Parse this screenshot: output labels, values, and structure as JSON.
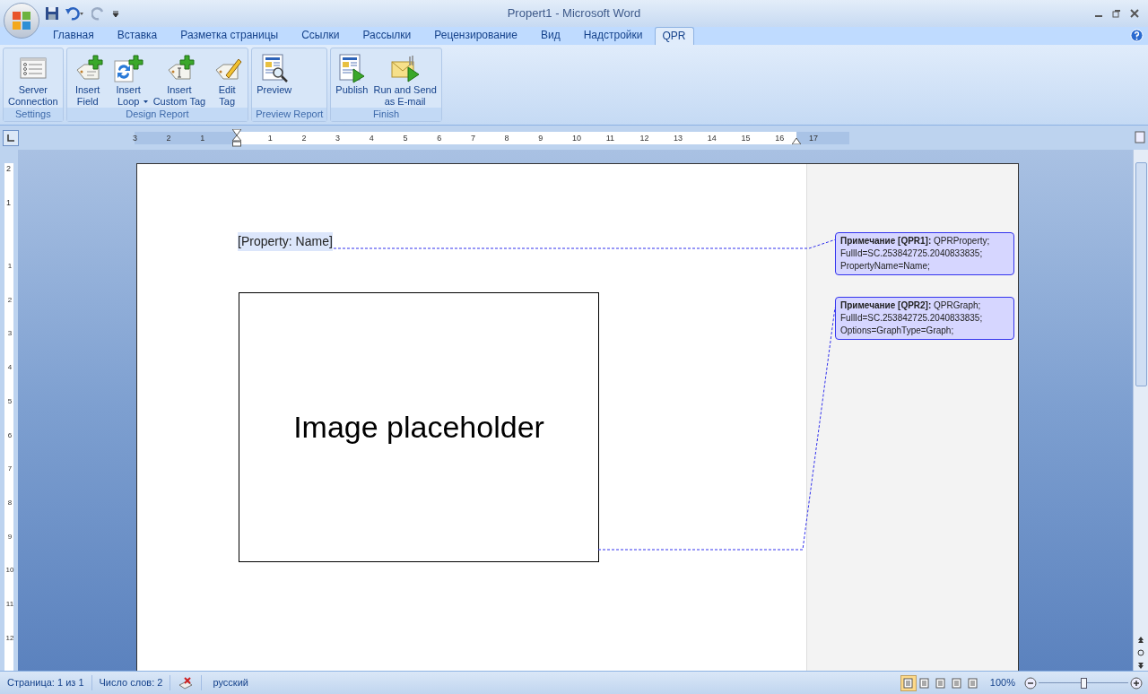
{
  "window": {
    "title": "Propert1 - Microsoft Word"
  },
  "tabs": [
    {
      "label": "Главная",
      "selected": false
    },
    {
      "label": "Вставка",
      "selected": false
    },
    {
      "label": "Разметка страницы",
      "selected": false
    },
    {
      "label": "Ссылки",
      "selected": false
    },
    {
      "label": "Рассылки",
      "selected": false
    },
    {
      "label": "Рецензирование",
      "selected": false
    },
    {
      "label": "Вид",
      "selected": false
    },
    {
      "label": "Надстройки",
      "selected": false
    },
    {
      "label": "QPR",
      "selected": true
    }
  ],
  "ribbon": [
    {
      "group": "Settings",
      "buttons": [
        {
          "label": "Server\nConnection",
          "kind": "server",
          "dropdown": false
        }
      ]
    },
    {
      "group": "Design Report",
      "buttons": [
        {
          "label": "Insert\nField",
          "kind": "field",
          "dropdown": false
        },
        {
          "label": "Insert\nLoop",
          "kind": "loop",
          "dropdown": true
        },
        {
          "label": "Insert\nCustom Tag",
          "kind": "custom",
          "dropdown": false
        },
        {
          "label": "Edit\nTag",
          "kind": "edit",
          "dropdown": false
        }
      ]
    },
    {
      "group": "Preview Report",
      "buttons": [
        {
          "label": "Preview",
          "kind": "preview",
          "dropdown": false
        }
      ]
    },
    {
      "group": "Finish",
      "buttons": [
        {
          "label": "Publish",
          "kind": "publish",
          "dropdown": false
        },
        {
          "label": "Run and Send\nas E-mail",
          "kind": "mail",
          "dropdown": false
        }
      ]
    }
  ],
  "ruler": {
    "left_labels": [
      "3",
      "2",
      "1"
    ],
    "right_labels": [
      "1",
      "2",
      "3",
      "4",
      "5",
      "6",
      "7",
      "8",
      "9",
      "10",
      "11",
      "12",
      "13",
      "14",
      "15",
      "16",
      "17"
    ],
    "vertical_top_labels": [
      "2",
      "1"
    ],
    "vertical_labels": [
      "1",
      "2",
      "3",
      "4",
      "5",
      "6",
      "7",
      "8",
      "9",
      "10",
      "11",
      "12"
    ]
  },
  "document": {
    "field": "[Property: Name]",
    "image_placeholder": "Image placeholder",
    "comments": [
      {
        "text": "**Примечание [QPR1]:** QPRProperty; FullId=SC.253842725.2040833835; PropertyName=Name;"
      },
      {
        "text": "**Примечание [QPR2]:** QPRGraph; FullId=SC.253842725.2040833835; Options=GraphType=Graph;"
      }
    ]
  },
  "status_bar": {
    "page": "Страница: 1 из 1",
    "words": "Число слов: 2",
    "language": "русский",
    "views": [
      {
        "selected": true
      },
      {
        "selected": false
      },
      {
        "selected": false
      },
      {
        "selected": false
      },
      {
        "selected": false
      }
    ],
    "zoom": "100%",
    "zoom_slider": {
      "level": 0.5
    }
  }
}
